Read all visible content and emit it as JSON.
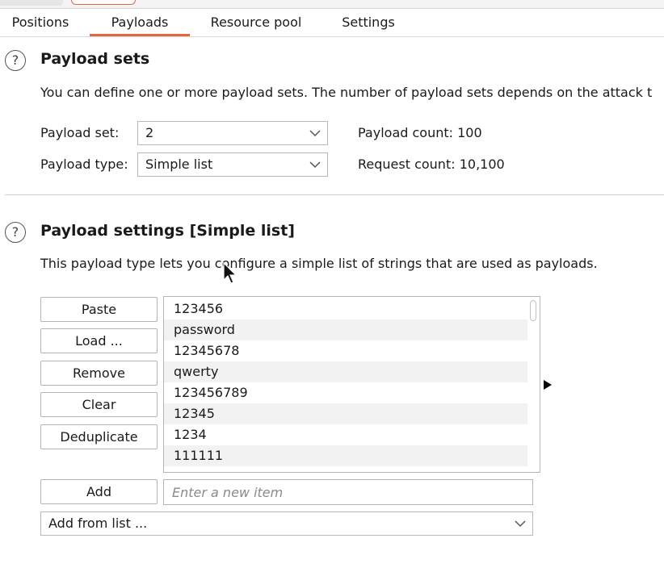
{
  "tabs": [
    "Positions",
    "Payloads",
    "Resource pool",
    "Settings"
  ],
  "payload_sets": {
    "help": "?",
    "title": "Payload sets",
    "description": "You can define one or more payload sets. The number of payload sets depends on the attack t",
    "set_label": "Payload set:",
    "set_value": "2",
    "type_label": "Payload type:",
    "type_value": "Simple list",
    "count_label": "Payload count:",
    "count_value": "100",
    "request_label": "Request count:",
    "request_value": "10,100"
  },
  "payload_settings": {
    "help": "?",
    "title": "Payload settings [Simple list]",
    "description": "This payload type lets you configure a simple list of strings that are used as payloads.",
    "buttons": {
      "paste": "Paste",
      "load": "Load ...",
      "remove": "Remove",
      "clear": "Clear",
      "deduplicate": "Deduplicate",
      "add": "Add"
    },
    "items": [
      "123456",
      "password",
      "12345678",
      "qwerty",
      "123456789",
      "12345",
      "1234",
      "111111"
    ],
    "new_item_placeholder": "Enter a new item",
    "add_from_list": "Add from list ..."
  },
  "colors": {
    "accent": "#e8643c",
    "row_alt": "#f2f2f2",
    "border": "#b5b5b5"
  },
  "icons": [
    "help-icon",
    "chevron-down-icon",
    "expand-arrow-icon",
    "mouse-cursor-icon"
  ]
}
